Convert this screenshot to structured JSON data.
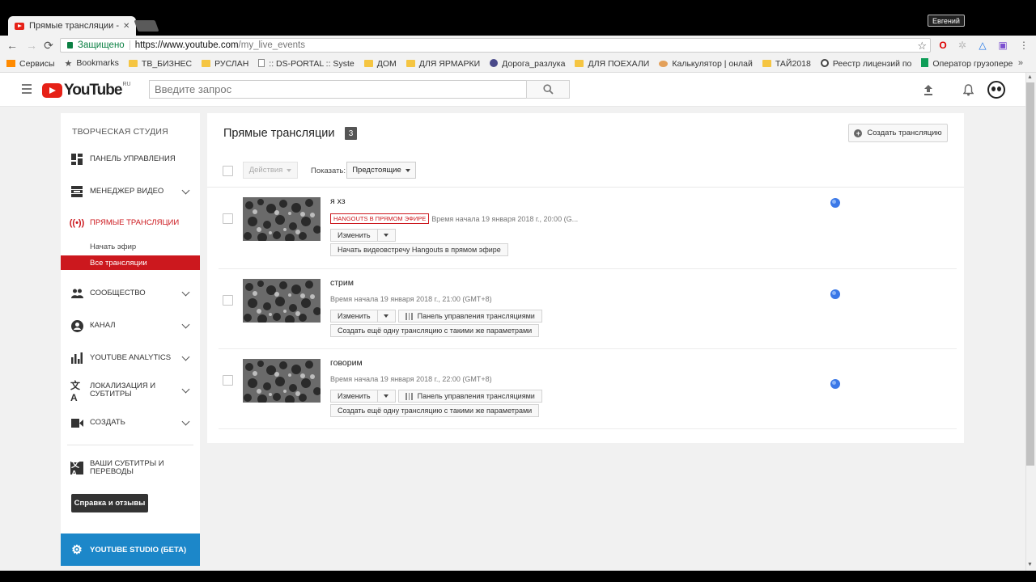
{
  "browser": {
    "tab_title": "Прямые трансляции - YouTube",
    "user_badge": "Евгений",
    "secure_label": "Защищено",
    "url_host": "https://www.youtube.com",
    "url_path": "/my_live_events",
    "bookmarks": [
      {
        "label": "Сервисы",
        "icon": "apps-grid"
      },
      {
        "label": "Bookmarks",
        "icon": "star"
      },
      {
        "label": "ТВ_БИЗНЕС",
        "icon": "folder"
      },
      {
        "label": "РУСЛАН",
        "icon": "folder"
      },
      {
        "label": ":: DS-PORTAL :: Syste",
        "icon": "page"
      },
      {
        "label": "ДОМ",
        "icon": "folder"
      },
      {
        "label": "ДЛЯ ЯРМАРКИ",
        "icon": "folder"
      },
      {
        "label": "Дорога_разлука",
        "icon": "person"
      },
      {
        "label": "ДЛЯ ПОЕХАЛИ",
        "icon": "folder"
      },
      {
        "label": "Калькулятор | онлай",
        "icon": "food"
      },
      {
        "label": "ТАЙ2018",
        "icon": "folder"
      },
      {
        "label": "Реестр лицензий по",
        "icon": "registry"
      },
      {
        "label": "Оператор грузопере",
        "icon": "sheet"
      }
    ],
    "more": "»"
  },
  "header": {
    "logo_text": "YouTube",
    "logo_region": "RU",
    "search_placeholder": "Введите запрос"
  },
  "sidebar": {
    "title": "ТВОРЧЕСКАЯ СТУДИЯ",
    "items": [
      {
        "label": "ПАНЕЛЬ УПРАВЛЕНИЯ"
      },
      {
        "label": "МЕНЕДЖЕР ВИДЕО"
      },
      {
        "label": "ПРЯМЫЕ ТРАНСЛЯЦИИ"
      },
      {
        "label": "СООБЩЕСТВО"
      },
      {
        "label": "КАНАЛ"
      },
      {
        "label": "YOUTUBE ANALYTICS"
      },
      {
        "label": "ЛОКАЛИЗАЦИЯ И СУБТИТРЫ"
      },
      {
        "label": "СОЗДАТЬ"
      },
      {
        "label": "ВАШИ СУБТИТРЫ И ПЕРЕВОДЫ"
      }
    ],
    "sub_start": "Начать эфир",
    "sub_all": "Все трансляции",
    "help": "Справка и отзывы",
    "studio_beta": "YOUTUBE STUDIO (БЕТА)"
  },
  "main": {
    "title": "Прямые трансляции",
    "count": "3",
    "create_label": "Создать трансляцию",
    "actions_label": "Действия",
    "show_label": "Показать:",
    "show_value": "Предстоящие",
    "events": [
      {
        "title": "я хз",
        "badge": "HANGOUTS В ПРЯМОМ ЭФИРЕ",
        "time": "Время начала 19 января 2018 г., 20:00 (G...",
        "edit": "Изменить",
        "second_action": "Начать видеовстречу Hangouts в прямом эфире"
      },
      {
        "title": "стрим",
        "time": "Время начала 19 января 2018 г., 21:00 (GMT+8)",
        "edit": "Изменить",
        "dashboard": "Панель управления трансляциями",
        "second_action": "Создать ещё одну трансляцию с такими же параметрами"
      },
      {
        "title": "говорим",
        "time": "Время начала 19 января 2018 г., 22:00 (GMT+8)",
        "edit": "Изменить",
        "dashboard": "Панель управления трансляциями",
        "second_action": "Создать ещё одну трансляцию с такими же параметрами"
      }
    ]
  }
}
